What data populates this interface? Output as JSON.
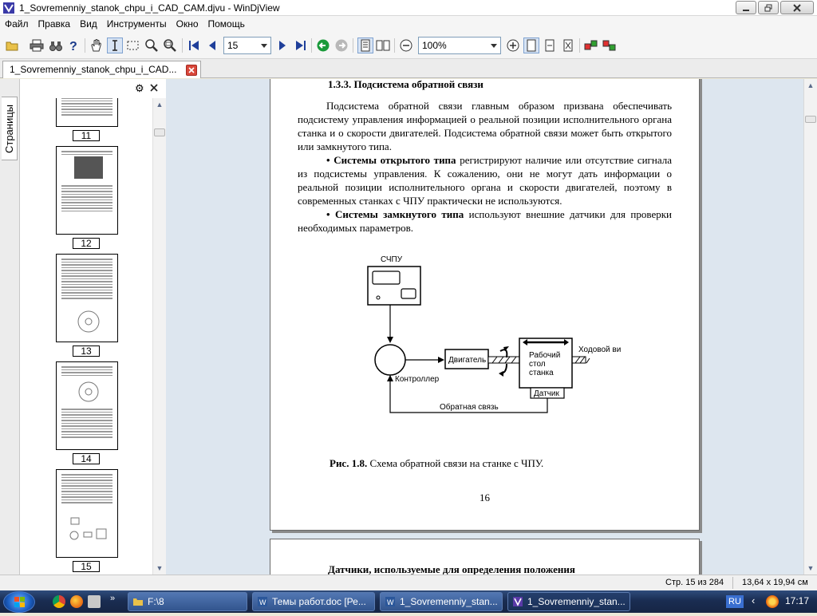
{
  "window": {
    "title": "1_Sovremenniy_stanok_chpu_i_CAD_CAM.djvu - WinDjView"
  },
  "menu": [
    "Файл",
    "Правка",
    "Вид",
    "Инструменты",
    "Окно",
    "Помощь"
  ],
  "toolbar": {
    "page_value": "15",
    "zoom_value": "100%"
  },
  "tab": {
    "label": "1_Sovremenniy_stanok_chpu_i_CAD..."
  },
  "sidebar": {
    "tab_label": "Страницы",
    "thumbnails": [
      {
        "page": "11"
      },
      {
        "page": "12"
      },
      {
        "page": "13"
      },
      {
        "page": "14"
      },
      {
        "page": "15"
      }
    ]
  },
  "document": {
    "section_heading": "1.3.3. Подсистема обратной связи",
    "para1": "Подсистема обратной связи главным образом призвана обеспечивать подсистему управления информацией о реальной позиции исполнительного органа станка и о скорости двигателей. Подсистема обратной связи может быть открытого или замкнутого типа.",
    "para2_bold": "• Системы открытого типа",
    "para2_rest": " регистрируют наличие или отсутствие сигнала из подсистемы управления. К сожалению, они не могут дать информации о реальной позиции исполнительного органа и скорости двигателей, поэтому в современных станках с ЧПУ практически не используются.",
    "para3_bold": "• Системы замкнутого типа",
    "para3_rest": " используют внешние датчики для проверки необходимых параметров.",
    "diagram": {
      "cnc_label": "СЧПУ",
      "motor_label": "Двигатель",
      "table_line1": "Рабочий",
      "table_line2": "стол",
      "table_line3": "станка",
      "screw_label": "Ходовой винт",
      "controller_label": "Контроллер",
      "sensor_label": "Датчик",
      "feedback_label": "Обратная связь"
    },
    "caption_bold": "Рис. 1.8.",
    "caption_text": " Схема обратной связи на станке с ЧПУ.",
    "page_number": "16",
    "next_page_heading": "Датчики, используемые для определения положения"
  },
  "status": {
    "page_info": "Стр. 15 из 284",
    "page_size": "13,64 x 19,94 см"
  },
  "taskbar": {
    "buttons": [
      {
        "label": "F:\\8"
      },
      {
        "label": "Темы работ.doc [Ре..."
      },
      {
        "label": "1_Sovremenniy_stan..."
      },
      {
        "label": "1_Sovremenniy_stan..."
      }
    ],
    "lang": "RU",
    "clock": "17:17"
  }
}
